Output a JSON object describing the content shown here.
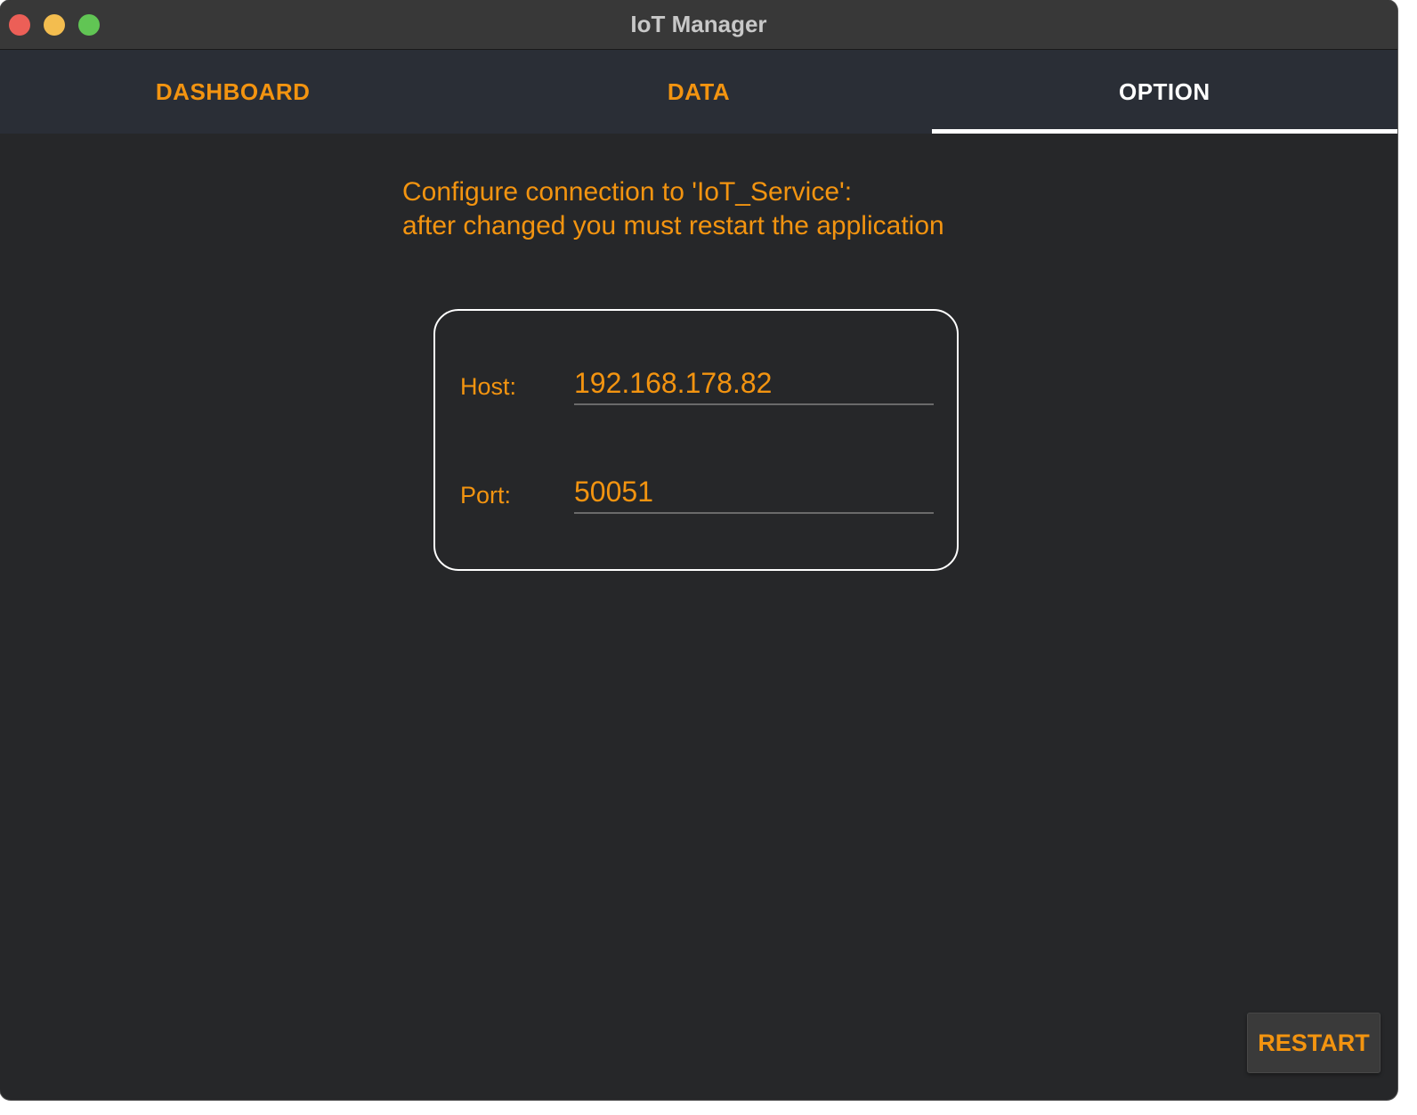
{
  "window": {
    "title": "IoT Manager"
  },
  "tabs": [
    {
      "label": "DASHBOARD",
      "active": false
    },
    {
      "label": "DATA",
      "active": false
    },
    {
      "label": "OPTION",
      "active": true
    }
  ],
  "option": {
    "info_line1": "Configure connection to 'IoT_Service':",
    "info_line2": "after changed you must restart the application",
    "host_label": "Host:",
    "host_value": "192.168.178.82",
    "port_label": "Port:",
    "port_value": "50051"
  },
  "actions": {
    "restart_label": "RESTART"
  },
  "colors": {
    "accent": "#f39410",
    "background": "#262729",
    "tabbar": "#2a2e36"
  }
}
